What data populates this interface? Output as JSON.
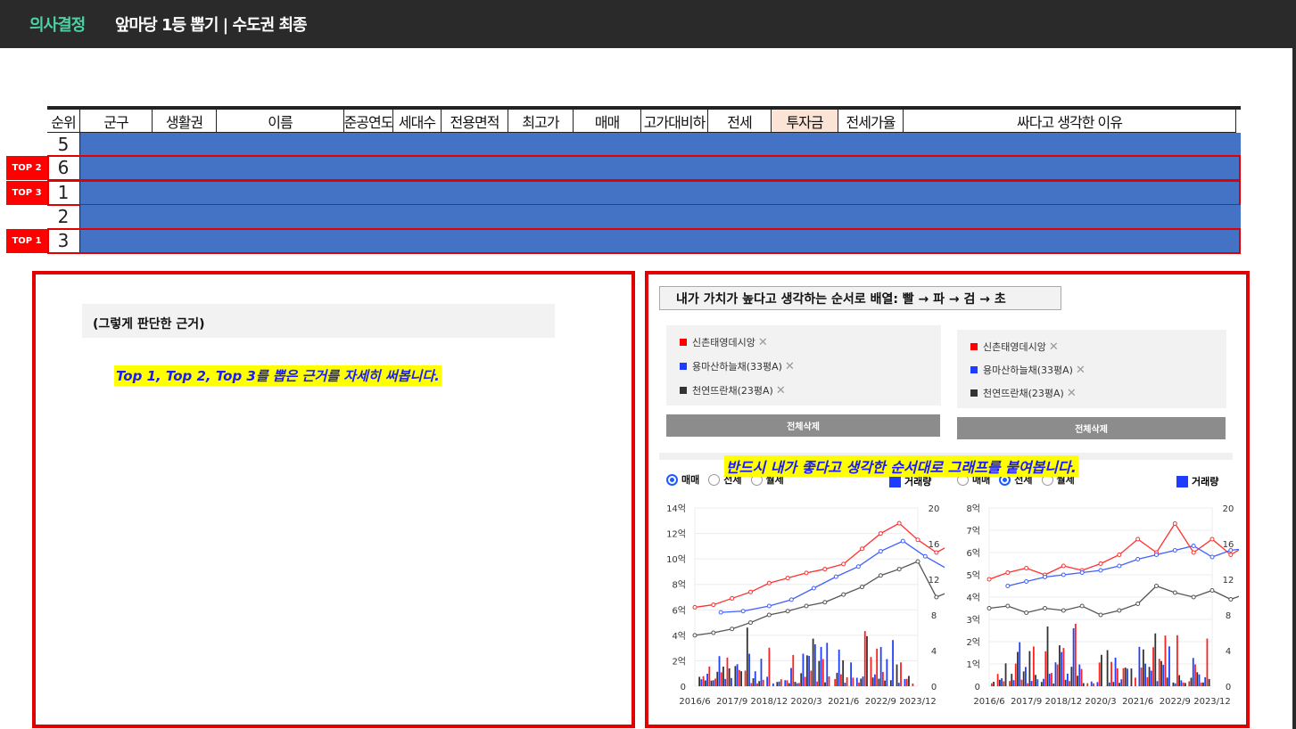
{
  "header": {
    "brand": "의사결정",
    "title": "앞마당 1등 뽑기 | 수도권 최종"
  },
  "table": {
    "columns": [
      "순위",
      "군구",
      "생활권",
      "이름",
      "준공연도",
      "세대수",
      "전용면적",
      "최고가",
      "매매",
      "고가대비하",
      "전세",
      "투자금",
      "전세가율",
      "싸다고 생각한 이유"
    ],
    "rows": [
      {
        "rank": "5",
        "tag": ""
      },
      {
        "rank": "6",
        "tag": "TOP 2"
      },
      {
        "rank": "1",
        "tag": "TOP 3"
      },
      {
        "rank": "2",
        "tag": ""
      },
      {
        "rank": "3",
        "tag": "TOP 1"
      }
    ]
  },
  "left_panel": {
    "heading": "(그렇게 판단한 근거)",
    "note": "Top 1, Top 2, Top 3를 뽑은 근거를 자세히 써봅니다."
  },
  "right_panel": {
    "order_label": "내가 가치가 높다고 생각하는  순서로 배열: 빨 → 파 → 검 → 초",
    "legend": [
      {
        "label": "신촌태영데시앙",
        "color": "#ff0000"
      },
      {
        "label": "용마산하늘채(33평A)",
        "color": "#1e3cff"
      },
      {
        "label": "천연뜨란채(23평A)",
        "color": "#333333"
      }
    ],
    "delete_all": "전체삭제",
    "graph_note": "반드시 내가 좋다고 생각한 순서대로 그래프를 붙여봅니다.",
    "radios": [
      "매매",
      "전세",
      "월세"
    ],
    "volume_label": "거래량"
  },
  "chart_data": [
    {
      "type": "line",
      "mode": "매매",
      "x_ticks": [
        "2016/6",
        "2017/9",
        "2018/12",
        "2020/3",
        "2021/6",
        "2022/9",
        "2023/12"
      ],
      "y_left_ticks": [
        "0",
        "2억",
        "4억",
        "6억",
        "8억",
        "10억",
        "12억",
        "14억"
      ],
      "y_right_ticks": [
        "0",
        "4",
        "8",
        "12",
        "16",
        "20"
      ],
      "ylim": [
        0,
        14
      ],
      "series": [
        {
          "name": "신촌태영데시앙",
          "color": "#ff3030",
          "x": [
            0,
            0.5,
            1,
            1.5,
            2,
            2.5,
            3,
            3.5,
            4,
            4.5,
            5,
            5.5,
            6,
            6.5,
            7,
            7.5,
            7.8
          ],
          "values": [
            6.2,
            6.4,
            6.9,
            7.4,
            8.1,
            8.5,
            8.9,
            9.2,
            9.6,
            10.8,
            12.0,
            12.8,
            11.5,
            10.5,
            11.3,
            11.8,
            9.7
          ]
        },
        {
          "name": "용마산하늘채(33평A)",
          "color": "#4060ff",
          "x": [
            0.7,
            1.3,
            2,
            2.6,
            3.2,
            3.8,
            4.4,
            5,
            5.6,
            6.2,
            6.8
          ],
          "values": [
            5.8,
            5.9,
            6.3,
            6.8,
            7.7,
            8.6,
            9.4,
            10.6,
            11.4,
            10.2,
            9.2
          ]
        },
        {
          "name": "천연뜨란채(23평A)",
          "color": "#555555",
          "x": [
            0,
            0.5,
            1,
            1.5,
            2,
            2.5,
            3,
            3.5,
            4,
            4.5,
            5,
            5.5,
            6,
            6.5,
            7,
            7.5,
            7.8
          ],
          "values": [
            4.0,
            4.2,
            4.5,
            5.0,
            5.6,
            5.9,
            6.3,
            6.6,
            7.2,
            7.8,
            8.7,
            9.2,
            9.8,
            7.0,
            7.6,
            8.1,
            7.6
          ]
        }
      ]
    },
    {
      "type": "line",
      "mode": "전세",
      "x_ticks": [
        "2016/6",
        "2017/9",
        "2018/12",
        "2020/3",
        "2021/6",
        "2022/9",
        "2023/12"
      ],
      "y_left_ticks": [
        "0",
        "1억",
        "2억",
        "3억",
        "4억",
        "5억",
        "6억",
        "7억",
        "8억"
      ],
      "y_right_ticks": [
        "0",
        "4",
        "8",
        "12",
        "16",
        "20"
      ],
      "ylim": [
        0,
        8
      ],
      "series": [
        {
          "name": "신촌태영데시앙",
          "color": "#ff3030",
          "x": [
            0,
            0.5,
            1,
            1.5,
            2,
            2.5,
            3,
            3.5,
            4,
            4.5,
            5,
            5.5,
            6,
            6.5,
            7,
            7.5,
            7.8
          ],
          "values": [
            4.8,
            5.1,
            5.3,
            5.0,
            5.4,
            5.2,
            5.5,
            5.9,
            6.6,
            6.0,
            7.3,
            6.0,
            6.6,
            5.9,
            6.4,
            6.9,
            5.2
          ]
        },
        {
          "name": "용마산하늘채(33평A)",
          "color": "#4060ff",
          "x": [
            0.5,
            1,
            1.5,
            2,
            2.5,
            3,
            3.5,
            4,
            4.5,
            5,
            5.5,
            6,
            6.5,
            7,
            7.5,
            7.8
          ],
          "values": [
            4.5,
            4.7,
            4.9,
            5.0,
            5.1,
            5.2,
            5.4,
            5.7,
            5.9,
            6.1,
            6.3,
            5.8,
            6.1,
            6.2,
            6.0,
            6.0
          ]
        },
        {
          "name": "천연뜨란채(23평A)",
          "color": "#555555",
          "x": [
            0,
            0.5,
            1,
            1.5,
            2,
            2.5,
            3,
            3.5,
            4,
            4.5,
            5,
            5.5,
            6,
            6.5,
            7,
            7.5,
            7.8
          ],
          "values": [
            3.5,
            3.6,
            3.3,
            3.5,
            3.4,
            3.6,
            3.2,
            3.4,
            3.7,
            4.5,
            4.2,
            4.0,
            4.3,
            3.9,
            4.2,
            4.6,
            4.8
          ]
        }
      ]
    }
  ]
}
